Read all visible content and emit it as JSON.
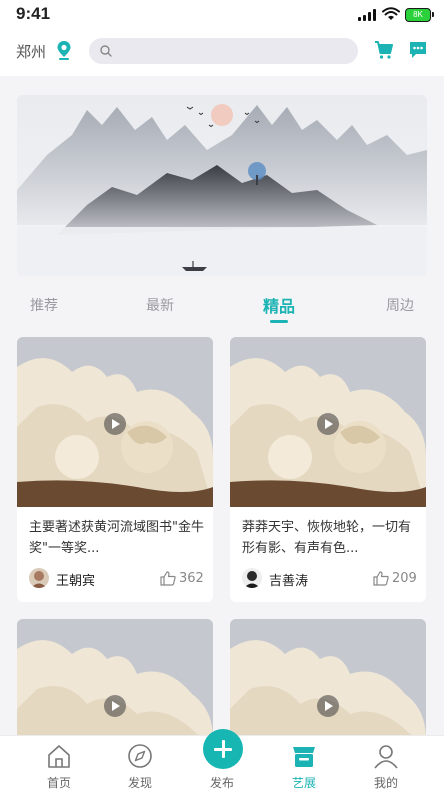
{
  "status_bar": {
    "time": "9:41",
    "battery": "8K"
  },
  "header": {
    "city": "郑州",
    "search": {
      "placeholder": ""
    }
  },
  "tabs": [
    {
      "label": "推荐"
    },
    {
      "label": "最新"
    },
    {
      "label": "精品"
    },
    {
      "label": "周边"
    }
  ],
  "active_tab": "精品",
  "cards": [
    {
      "desc": "主要著述获黄河流域图书\"金牛奖\"一等奖...",
      "author": "王朝宾",
      "likes": "362"
    },
    {
      "desc": "莽莽天宇、恢恢地轮，一切有形有影、有声有色...",
      "author": "吉善涛",
      "likes": "209"
    },
    {
      "desc": "",
      "author": "",
      "likes": ""
    },
    {
      "desc": "",
      "author": "",
      "likes": ""
    }
  ],
  "bottom_nav": [
    {
      "label": "首页",
      "icon": "home-icon"
    },
    {
      "label": "发现",
      "icon": "compass-icon"
    },
    {
      "label": "发布",
      "icon": "plus-icon"
    },
    {
      "label": "艺展",
      "icon": "store-icon"
    },
    {
      "label": "我的",
      "icon": "user-icon"
    }
  ],
  "colors": {
    "accent": "#1bb3b3",
    "fab": "#17b6b2"
  }
}
